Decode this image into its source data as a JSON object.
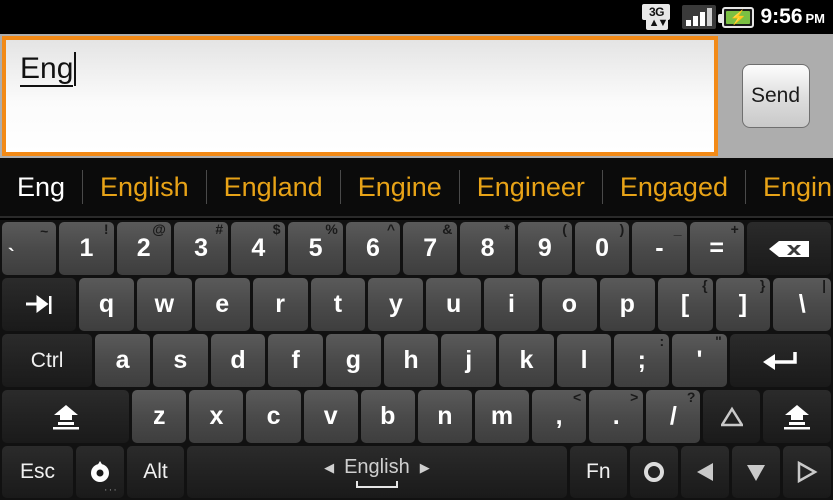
{
  "statusbar": {
    "network_label": "3G",
    "network_arrows": "⬆⬇",
    "signal_icon": "signal-bars-icon",
    "battery_icon": "battery-charging-icon",
    "battery_bolt": "⚡",
    "time": "9:56",
    "ampm": "PM"
  },
  "compose": {
    "text": "Eng",
    "send_label": "Send"
  },
  "suggestions": [
    {
      "label": "Eng",
      "active": true
    },
    {
      "label": "English",
      "active": false
    },
    {
      "label": "England",
      "active": false
    },
    {
      "label": "Engine",
      "active": false
    },
    {
      "label": "Engineer",
      "active": false
    },
    {
      "label": "Engaged",
      "active": false
    },
    {
      "label": "Engineers",
      "active": false
    }
  ],
  "keyboard": {
    "row1": [
      {
        "main": "`",
        "sup": "~",
        "name": "key-grave"
      },
      {
        "main": "1",
        "sup": "!",
        "name": "key-1"
      },
      {
        "main": "2",
        "sup": "@",
        "name": "key-2"
      },
      {
        "main": "3",
        "sup": "#",
        "name": "key-3"
      },
      {
        "main": "4",
        "sup": "$",
        "name": "key-4"
      },
      {
        "main": "5",
        "sup": "%",
        "name": "key-5"
      },
      {
        "main": "6",
        "sup": "^",
        "name": "key-6"
      },
      {
        "main": "7",
        "sup": "&",
        "name": "key-7"
      },
      {
        "main": "8",
        "sup": "*",
        "name": "key-8"
      },
      {
        "main": "9",
        "sup": "(",
        "name": "key-9"
      },
      {
        "main": "0",
        "sup": ")",
        "name": "key-0"
      },
      {
        "main": "-",
        "sup": "_",
        "name": "key-minus"
      },
      {
        "main": "=",
        "sup": "+",
        "name": "key-equals"
      },
      {
        "main": "",
        "sup": "",
        "name": "key-backspace",
        "icon": "backspace-icon"
      }
    ],
    "row2": [
      {
        "main": "",
        "sup": "",
        "name": "key-tab",
        "icon": "tab-icon"
      },
      {
        "main": "q",
        "sup": "",
        "name": "key-q"
      },
      {
        "main": "w",
        "sup": "",
        "name": "key-w"
      },
      {
        "main": "e",
        "sup": "",
        "name": "key-e"
      },
      {
        "main": "r",
        "sup": "",
        "name": "key-r"
      },
      {
        "main": "t",
        "sup": "",
        "name": "key-t"
      },
      {
        "main": "y",
        "sup": "",
        "name": "key-y"
      },
      {
        "main": "u",
        "sup": "",
        "name": "key-u"
      },
      {
        "main": "i",
        "sup": "",
        "name": "key-i"
      },
      {
        "main": "o",
        "sup": "",
        "name": "key-o"
      },
      {
        "main": "p",
        "sup": "",
        "name": "key-p"
      },
      {
        "main": "[",
        "sup": "{",
        "name": "key-bracket-left"
      },
      {
        "main": "]",
        "sup": "}",
        "name": "key-bracket-right"
      },
      {
        "main": "\\",
        "sup": "|",
        "name": "key-backslash"
      }
    ],
    "row3": [
      {
        "main": "Ctrl",
        "sup": "",
        "name": "key-ctrl"
      },
      {
        "main": "a",
        "sup": "",
        "name": "key-a"
      },
      {
        "main": "s",
        "sup": "",
        "name": "key-s"
      },
      {
        "main": "d",
        "sup": "",
        "name": "key-d"
      },
      {
        "main": "f",
        "sup": "",
        "name": "key-f"
      },
      {
        "main": "g",
        "sup": "",
        "name": "key-g"
      },
      {
        "main": "h",
        "sup": "",
        "name": "key-h"
      },
      {
        "main": "j",
        "sup": "",
        "name": "key-j"
      },
      {
        "main": "k",
        "sup": "",
        "name": "key-k"
      },
      {
        "main": "l",
        "sup": "",
        "name": "key-l"
      },
      {
        "main": ";",
        "sup": ":",
        "name": "key-semicolon"
      },
      {
        "main": "'",
        "sup": "\"",
        "name": "key-apostrophe"
      },
      {
        "main": "",
        "sup": "",
        "name": "key-enter",
        "icon": "enter-icon"
      }
    ],
    "row4": [
      {
        "main": "",
        "sup": "",
        "name": "key-shift-left",
        "icon": "shift-icon"
      },
      {
        "main": "z",
        "sup": "",
        "name": "key-z"
      },
      {
        "main": "x",
        "sup": "",
        "name": "key-x"
      },
      {
        "main": "c",
        "sup": "",
        "name": "key-c"
      },
      {
        "main": "v",
        "sup": "",
        "name": "key-v"
      },
      {
        "main": "b",
        "sup": "",
        "name": "key-b"
      },
      {
        "main": "n",
        "sup": "",
        "name": "key-n"
      },
      {
        "main": "m",
        "sup": "",
        "name": "key-m"
      },
      {
        "main": ",",
        "sup": "<",
        "name": "key-comma"
      },
      {
        "main": ".",
        "sup": ">",
        "name": "key-period"
      },
      {
        "main": "/",
        "sup": "?",
        "name": "key-slash"
      },
      {
        "main": "",
        "sup": "",
        "name": "key-arrow-up",
        "icon": "arrow-up-icon"
      },
      {
        "main": "",
        "sup": "",
        "name": "key-shift-right",
        "icon": "shift-icon"
      }
    ],
    "row5": [
      {
        "main": "Esc",
        "sup": "",
        "name": "key-esc"
      },
      {
        "main": "",
        "sup": "",
        "name": "key-settings",
        "icon": "settings-icon"
      },
      {
        "main": "Alt",
        "sup": "",
        "name": "key-alt"
      },
      {
        "main": "",
        "sup": "",
        "name": "key-space",
        "icon": "space-icon"
      },
      {
        "main": "Fn",
        "sup": "",
        "name": "key-fn"
      },
      {
        "main": "",
        "sup": "",
        "name": "key-ring",
        "icon": "ring-icon"
      },
      {
        "main": "",
        "sup": "",
        "name": "key-arrow-left",
        "icon": "arrow-left-icon"
      },
      {
        "main": "",
        "sup": "",
        "name": "key-arrow-down",
        "icon": "arrow-down-icon"
      },
      {
        "main": "",
        "sup": "",
        "name": "key-arrow-right",
        "icon": "arrow-right-icon"
      }
    ],
    "spacebar": {
      "language": "English",
      "left_arrow": "◀",
      "right_arrow": "▶"
    }
  },
  "colors": {
    "accent_orange": "#f28a17",
    "suggestion_gold": "#e8a317",
    "battery_green": "#7bc043",
    "key_face": "#4a4a4a",
    "mod_key": "#222222"
  }
}
